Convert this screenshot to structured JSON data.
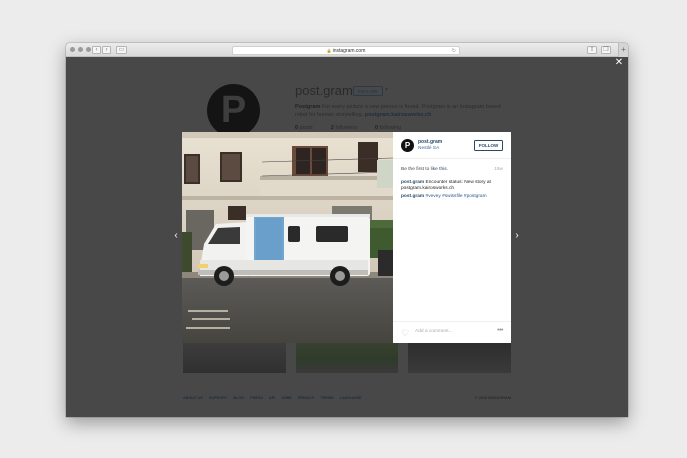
{
  "browser": {
    "url": "instagram.com",
    "back": "‹",
    "forward": "›",
    "reload": "↻",
    "new_tab": "+"
  },
  "profile": {
    "initial": "P",
    "name": "post.gram",
    "follow_label": "FOLLOW",
    "caret": "▾",
    "bio_name": "Postgram",
    "bio_text": " For every picture a new person is found. Postgram is an Instagram based robot for human storytelling. ",
    "bio_site": "postgram.kairosworks.ch",
    "stats": [
      {
        "count": "6",
        "label": " posts"
      },
      {
        "count": "2",
        "label": " followers"
      },
      {
        "count": "0",
        "label": " following"
      }
    ]
  },
  "modal": {
    "close": "✕",
    "prev": "‹",
    "next": "›",
    "initial": "P",
    "username": "post.gram",
    "location": "Nestlé SA",
    "follow_label": "FOLLOW",
    "likes_prefix": "Be the first to ",
    "likes_link": "like this.",
    "time": "15w",
    "caption_user": "post.gram",
    "caption_text": " Encounter status: New story at postgram.kairosworks.ch",
    "tags_user": "post.gram",
    "tags": " #vevey #swissfile #postgram",
    "comment_placeholder": "Add a comment...",
    "more": "•••"
  },
  "footer": {
    "links": [
      "ABOUT US",
      "SUPPORT",
      "BLOG",
      "PRESS",
      "API",
      "JOBS",
      "PRIVACY",
      "TERMS",
      "LANGUAGE"
    ],
    "copyright": "© 2015 INSTAGRAM"
  }
}
